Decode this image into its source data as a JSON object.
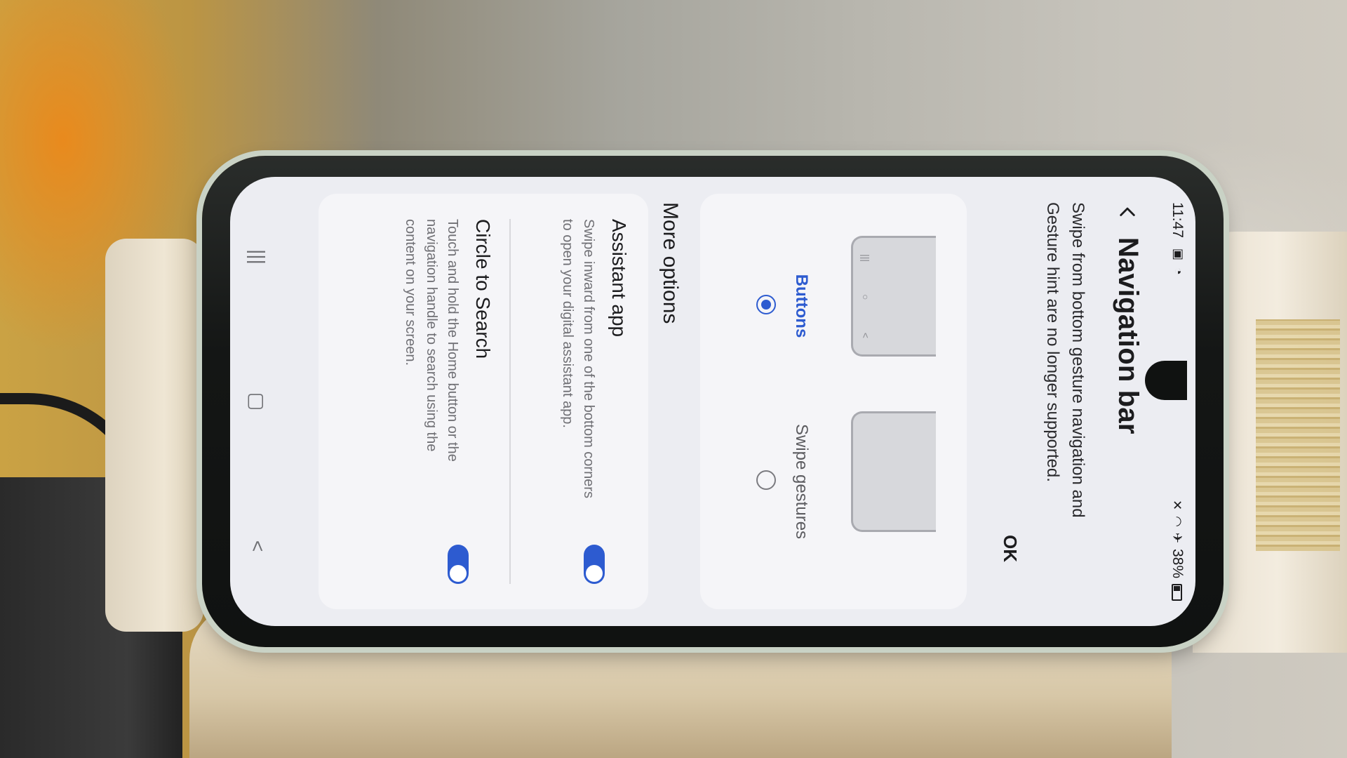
{
  "status_bar": {
    "time": "11:47",
    "battery": "38%",
    "icons": [
      "photo-icon",
      "sync-icon",
      "mute-icon",
      "wifi-icon",
      "airplane-icon",
      "battery-icon"
    ]
  },
  "header": {
    "title": "Navigation bar"
  },
  "notice": {
    "text": "Swipe from bottom gesture navigation and Gesture hint are no longer supported.",
    "ok_label": "OK"
  },
  "navigation_types": [
    {
      "label": "Buttons",
      "selected": true
    },
    {
      "label": "Swipe gestures",
      "selected": false
    }
  ],
  "more_options": {
    "title": "More options",
    "items": [
      {
        "title": "Assistant app",
        "description": "Swipe inward from one of the bottom corners to open your digital assistant app.",
        "enabled": true
      },
      {
        "title": "Circle to Search",
        "description": "Touch and hold the Home button or the navigation handle to search using the content on your screen.",
        "enabled": true
      }
    ]
  },
  "system_nav": {
    "recents": "|||",
    "home": "▢",
    "back": "<"
  },
  "colors": {
    "accent": "#2d5bd0",
    "screen_bg": "#ecedf2",
    "card_bg": "#f5f5f8"
  }
}
